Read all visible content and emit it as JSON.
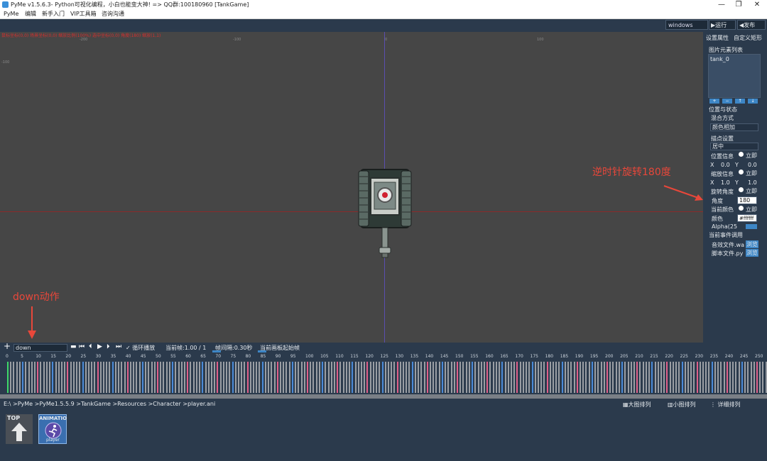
{
  "titlebar": {
    "title": "PyMe v1.5.6.3- Python可视化编程，小白也能变大神!   => QQ群:100180960   [TankGame]",
    "minimize": "—",
    "restore": "❐",
    "close": "✕"
  },
  "menubar": {
    "items": [
      "PyMe",
      "编辑",
      "新手入门",
      "VIP工具箱",
      "咨询沟通"
    ]
  },
  "toolbar": {
    "platform": "windows",
    "run_label": "▶运行",
    "publish_label": "◀发布"
  },
  "canvas": {
    "coord_text": "鼠标坐标(0,0) 场景坐标(0,0) 缩放比例(100%) 选中坐标(0,0) 角度(180) 缩放(1,1)",
    "ruler_marks": [
      "-200",
      "-100",
      "0",
      "100"
    ],
    "side_mark": "-100"
  },
  "right_panel": {
    "tab_properties": "设置属性",
    "tab_custom": "自定义矩形",
    "elem_list_title": "图片元素列表",
    "elements": [
      "tank_0"
    ],
    "list_buttons": [
      "+",
      "−",
      "↑",
      "↓"
    ],
    "pos_state": "位置与状态",
    "blend_label": "混合方式",
    "blend_value": "颜色相加",
    "anchor_label": "描点设置",
    "anchor_value": "居中",
    "pos_info": "位置信息",
    "pos_x_label": "X",
    "pos_x": "0.0",
    "pos_y_label": "Y",
    "pos_y": "0.0",
    "scale_info": "缩放信息",
    "scale_x_label": "X",
    "scale_x": "1.0",
    "scale_y_label": "Y",
    "scale_y": "1.0",
    "rotate_info": "旋转角度",
    "angle_label": "角度",
    "angle_value": "180",
    "color_info": "当前颜色",
    "color_label": "颜色",
    "color_value": "#ffffff",
    "alpha_label": "Alpha(25",
    "immediate": "立即",
    "event_title": "当前事件调用",
    "sound_file": "音效文件.wa",
    "script_file": "脚本文件.py",
    "browse": "浏览"
  },
  "annotations": {
    "rotate_note": "逆时针旋转180度",
    "action_note": "down动作"
  },
  "timeline": {
    "add": "+",
    "action_value": "down",
    "loop_label": "✓ 循环播放",
    "current_frame": "当前帧:1.00 / 1",
    "interval": "帧间隔:0.30秒",
    "start_frame": "当前画板起始帧",
    "ruler_numbers": [
      "0",
      "5",
      "10",
      "15",
      "20",
      "25",
      "30",
      "35",
      "40",
      "45",
      "50",
      "55",
      "60",
      "65",
      "70",
      "75",
      "80",
      "85",
      "90",
      "95",
      "100",
      "105",
      "110",
      "115",
      "120",
      "125",
      "130",
      "135",
      "140",
      "145",
      "150",
      "155",
      "160",
      "165",
      "170",
      "175",
      "180",
      "185",
      "190",
      "195",
      "200",
      "205",
      "210",
      "215",
      "220",
      "225",
      "230",
      "235",
      "240",
      "245",
      "250"
    ]
  },
  "filebrowser": {
    "path": "E:\\ >PyMe >PyMe1.5.5.9 >TankGame >Resources >Character >player.ani",
    "large_icons": "▦大图排列",
    "small_icons": "▥小图排列",
    "detail": "⋮ 详细排列",
    "tile_top": "TOP",
    "tile_anim": "ANIMATIO",
    "tile_anim_sub": "player"
  },
  "colors": {
    "panel_bg": "#2b3a4c",
    "canvas_bg": "#464646",
    "annotation": "#e8473a",
    "frame_blue": "#4a8ad8",
    "frame_pink": "#e0608a",
    "frame_gray": "#9a9ea4",
    "frame_green": "#3fd86a"
  }
}
